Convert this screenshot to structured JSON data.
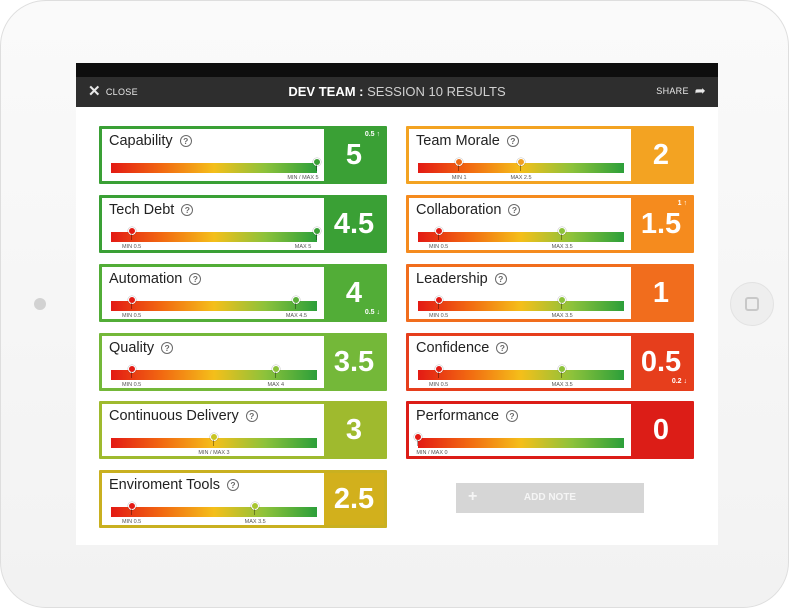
{
  "header": {
    "close_label": "CLOSE",
    "title_team": "DEV TEAM",
    "title_separator": ":",
    "title_session": "SESSION 10 RESULTS",
    "share_label": "SHARE"
  },
  "metrics": [
    {
      "name": "Capability",
      "score": "5",
      "color": "#3aa035",
      "score_bg": "#3aa035",
      "markers": [
        {
          "value": 1.0,
          "color": "#3aa035"
        }
      ],
      "ticks": [
        {
          "text": "MIN / MAX 5",
          "value": 1.0
        }
      ],
      "trend_up": "0.5",
      "trend_down": ""
    },
    {
      "name": "Tech Debt",
      "score": "4.5",
      "color": "#3aa035",
      "score_bg": "#3aa035",
      "markers": [
        {
          "value": 0.1,
          "color": "#e31a14"
        },
        {
          "value": 1.0,
          "color": "#3aa035"
        }
      ],
      "ticks": [
        {
          "text": "MIN 0.5",
          "value": 0.1
        },
        {
          "text": "MAX 5",
          "value": 1.0
        }
      ],
      "trend_up": "",
      "trend_down": ""
    },
    {
      "name": "Automation",
      "score": "4",
      "color": "#52ad37",
      "score_bg": "#52ad37",
      "markers": [
        {
          "value": 0.1,
          "color": "#e31a14"
        },
        {
          "value": 0.9,
          "color": "#5caf3a"
        }
      ],
      "ticks": [
        {
          "text": "MIN 0.5",
          "value": 0.1
        },
        {
          "text": "MAX 4.5",
          "value": 0.9
        }
      ],
      "trend_up": "",
      "trend_down": "0.5"
    },
    {
      "name": "Quality",
      "score": "3.5",
      "color": "#74b839",
      "score_bg": "#74b839",
      "markers": [
        {
          "value": 0.1,
          "color": "#e31a14"
        },
        {
          "value": 0.8,
          "color": "#8cc23b"
        }
      ],
      "ticks": [
        {
          "text": "MIN 0.5",
          "value": 0.1
        },
        {
          "text": "MAX 4",
          "value": 0.8
        }
      ],
      "trend_up": "",
      "trend_down": ""
    },
    {
      "name": "Continuous Delivery",
      "score": "3",
      "color": "#9fba2e",
      "score_bg": "#9fba2e",
      "markers": [
        {
          "value": 0.5,
          "color": "#c9c524"
        }
      ],
      "ticks": [
        {
          "text": "MIN / MAX 3",
          "value": 0.5
        }
      ],
      "trend_up": "",
      "trend_down": ""
    },
    {
      "name": "Enviroment Tools",
      "score": "2.5",
      "color": "#c9b020",
      "score_bg": "#d2b01c",
      "markers": [
        {
          "value": 0.1,
          "color": "#e31a14"
        },
        {
          "value": 0.7,
          "color": "#a8c530"
        }
      ],
      "ticks": [
        {
          "text": "MIN 0.5",
          "value": 0.1
        },
        {
          "text": "MAX 3.5",
          "value": 0.7
        }
      ],
      "trend_up": "",
      "trend_down": ""
    },
    {
      "name": "Team Morale",
      "score": "2",
      "color": "#f3a322",
      "score_bg": "#f3a322",
      "markers": [
        {
          "value": 0.2,
          "color": "#ee6a14"
        },
        {
          "value": 0.5,
          "color": "#f0a020"
        }
      ],
      "ticks": [
        {
          "text": "MIN 1",
          "value": 0.2
        },
        {
          "text": "MAX 2.5",
          "value": 0.5
        }
      ],
      "trend_up": "",
      "trend_down": ""
    },
    {
      "name": "Collaboration",
      "score": "1.5",
      "color": "#f58b1e",
      "score_bg": "#f58b1e",
      "markers": [
        {
          "value": 0.1,
          "color": "#e31a14"
        },
        {
          "value": 0.7,
          "color": "#8cc23b"
        }
      ],
      "ticks": [
        {
          "text": "MIN 0.5",
          "value": 0.1
        },
        {
          "text": "MAX 3.5",
          "value": 0.7
        }
      ],
      "trend_up": "1",
      "trend_down": ""
    },
    {
      "name": "Leadership",
      "score": "1",
      "color": "#f16d1d",
      "score_bg": "#f16d1d",
      "markers": [
        {
          "value": 0.1,
          "color": "#e31a14"
        },
        {
          "value": 0.7,
          "color": "#8cc23b"
        }
      ],
      "ticks": [
        {
          "text": "MIN 0.5",
          "value": 0.1
        },
        {
          "text": "MAX 3.5",
          "value": 0.7
        }
      ],
      "trend_up": "",
      "trend_down": ""
    },
    {
      "name": "Confidence",
      "score": "0.5",
      "color": "#e63e1c",
      "score_bg": "#e63e1c",
      "markers": [
        {
          "value": 0.1,
          "color": "#e31a14"
        },
        {
          "value": 0.7,
          "color": "#8cc23b"
        }
      ],
      "ticks": [
        {
          "text": "MIN 0.5",
          "value": 0.1
        },
        {
          "text": "MAX 3.5",
          "value": 0.7
        }
      ],
      "trend_up": "",
      "trend_down": "0.2"
    },
    {
      "name": "Performance",
      "score": "0",
      "color": "#dc1d17",
      "score_bg": "#dc1d17",
      "markers": [
        {
          "value": 0.0,
          "color": "#e31a14"
        }
      ],
      "ticks": [
        {
          "text": "MIN / MAX 0",
          "value": 0.0
        }
      ],
      "trend_up": "",
      "trend_down": ""
    }
  ],
  "add_note_label": "ADD NOTE"
}
